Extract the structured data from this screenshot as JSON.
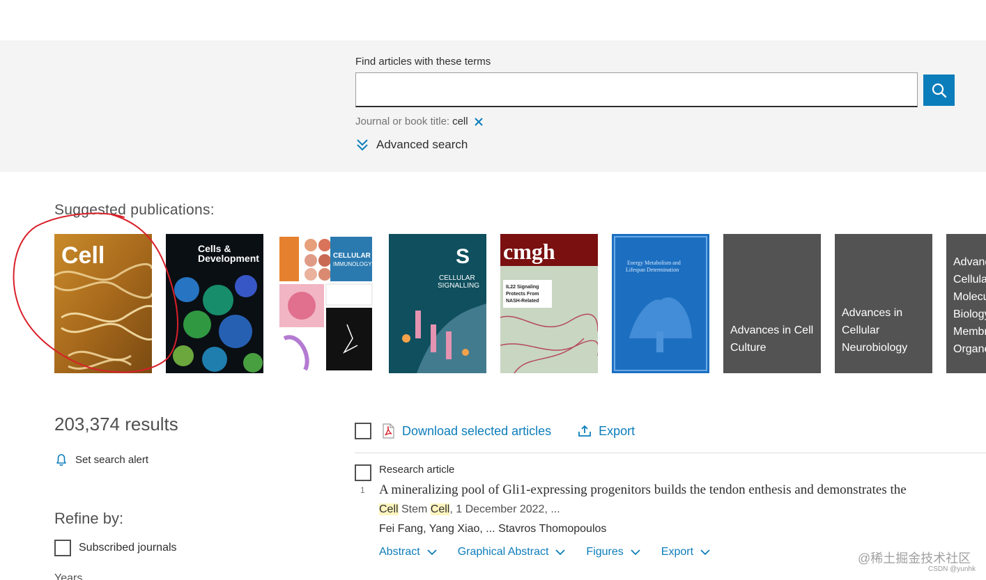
{
  "search": {
    "find_label": "Find articles with these terms",
    "query_value": "",
    "filter_label": "Journal or book title:",
    "filter_value": "cell",
    "advanced_label": "Advanced search"
  },
  "suggested": {
    "heading": "Suggested publications:",
    "publications": [
      {
        "kind": "cover",
        "title": "Cell"
      },
      {
        "kind": "cover",
        "title": "Cells & Development"
      },
      {
        "kind": "cover",
        "title": "CELLULAR IMMUNOLOGY"
      },
      {
        "kind": "cover",
        "title": "CELLULAR SIGNALLING"
      },
      {
        "kind": "cover",
        "title": "cmgh"
      },
      {
        "kind": "cover",
        "title": "Energy Metabolism and Lifespan Determination"
      },
      {
        "kind": "tile",
        "label": "Advances in Cell Culture"
      },
      {
        "kind": "tile",
        "label": "Advances in Cellular Neurobiology"
      },
      {
        "kind": "tile",
        "label": "Advances in Cellular and Molecular Biology of Membranes and Organelles"
      }
    ]
  },
  "results": {
    "count": "203,374 results",
    "alert_label": "Set search alert",
    "refine_heading": "Refine by:",
    "subscribed_label": "Subscribed journals",
    "years_label": "Years",
    "download_label": "Download selected articles",
    "export_label": "Export"
  },
  "article": {
    "type": "Research article",
    "number": "1",
    "title": "A mineralizing pool of Gli1-expressing progenitors builds the tendon enthesis and demonstrates the",
    "journal_highlight_1": "Cell",
    "journal_mid": " Stem ",
    "journal_highlight_2": "Cell",
    "date": ", 1 December 2022, ...",
    "authors": "Fei Fang, Yang Xiao, ... Stavros Thomopoulos",
    "links": [
      "Abstract",
      "Graphical Abstract",
      "Figures",
      "Export"
    ]
  },
  "watermark": {
    "text": "@稀土掘金技术社区",
    "sub": "CSDN @yunhk"
  },
  "colors": {
    "accent": "#0c7dbb",
    "band": "#f4f4f4",
    "tile": "#535353",
    "highlight": "#fdf4be",
    "annotation": "#d9202a"
  }
}
